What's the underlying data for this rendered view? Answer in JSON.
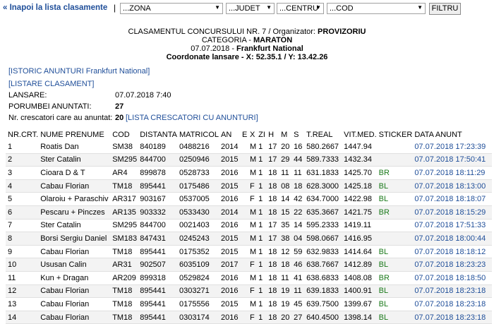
{
  "nav": {
    "back_label": "« Inapoi la lista clasamente",
    "separator": "|",
    "zona": "...ZONA",
    "judet": "...JUDET",
    "centru": "...CENTRU",
    "cod": "...COD",
    "filter_button": "FILTRU"
  },
  "header": {
    "line1_prefix": "CLASAMENTUL CONCURSULUI NR. 7 / Organizator: ",
    "line1_bold": "PROVIZORIU",
    "line2_prefix": "CATEGORIA - ",
    "line2_bold": "MARATON",
    "line3_prefix": "07.07.2018 - ",
    "line3_bold": "Frankfurt National",
    "line4": "Coordonate lansare - X: 52.35.1 / Y: 13.42.26"
  },
  "links": {
    "istoric": "[ISTORIC ANUNTURI Frankfurt National]",
    "listare": "[LISTARE CLASAMENT]",
    "lista_crescatori": "[LISTA CRESCATORI CU ANUNTURI]"
  },
  "info": {
    "lansare_label": "LANSARE:",
    "lansare_value": "07.07.2018 7:40",
    "porumbei_label": "PORUMBEI ANUNTATI:",
    "porumbei_value": "27",
    "crescatori_label": "Nr. crescatori care au anuntat:",
    "crescatori_value": "20"
  },
  "table": {
    "columns": [
      "NR.CRT.",
      "NUME PRENUME",
      "COD",
      "DISTANTA",
      "MATRICOL",
      "AN",
      "E",
      "X",
      "ZI",
      "H",
      "M",
      "S",
      "T.REAL",
      "VIT.MED.",
      "STICKER",
      "DATA ANUNT"
    ],
    "rows": [
      [
        "1",
        "Roatis Dan",
        "SM38",
        "840189",
        "0488216",
        "2014",
        "",
        "M",
        "1",
        "17",
        "20",
        "16",
        "580.2667",
        "1447.94",
        "",
        "07.07.2018 17:23:39"
      ],
      [
        "2",
        "Ster Catalin",
        "SM295",
        "844700",
        "0250946",
        "2015",
        "",
        "M",
        "1",
        "17",
        "29",
        "44",
        "589.7333",
        "1432.34",
        "",
        "07.07.2018 17:50:41"
      ],
      [
        "3",
        "Cioara D & T",
        "AR4",
        "899878",
        "0528733",
        "2016",
        "",
        "M",
        "1",
        "18",
        "11",
        "11",
        "631.1833",
        "1425.70",
        "BR",
        "07.07.2018 18:11:29"
      ],
      [
        "4",
        "Cabau Florian",
        "TM18",
        "895441",
        "0175486",
        "2015",
        "",
        "F",
        "1",
        "18",
        "08",
        "18",
        "628.3000",
        "1425.18",
        "BL",
        "07.07.2018 18:13:00"
      ],
      [
        "5",
        "Olaroiu + Paraschiv",
        "AR317",
        "903167",
        "0537005",
        "2016",
        "",
        "F",
        "1",
        "18",
        "14",
        "42",
        "634.7000",
        "1422.98",
        "BL",
        "07.07.2018 18:18:07"
      ],
      [
        "6",
        "Pescaru + Pinczes",
        "AR135",
        "903332",
        "0533430",
        "2014",
        "",
        "M",
        "1",
        "18",
        "15",
        "22",
        "635.3667",
        "1421.75",
        "BR",
        "07.07.2018 18:15:29"
      ],
      [
        "7",
        "Ster Catalin",
        "SM295",
        "844700",
        "0021403",
        "2016",
        "",
        "M",
        "1",
        "17",
        "35",
        "14",
        "595.2333",
        "1419.11",
        "",
        "07.07.2018 17:51:33"
      ],
      [
        "8",
        "Borsi Sergiu Daniel",
        "SM183",
        "847431",
        "0245243",
        "2015",
        "",
        "M",
        "1",
        "17",
        "38",
        "04",
        "598.0667",
        "1416.95",
        "",
        "07.07.2018 18:00:44"
      ],
      [
        "9",
        "Cabau Florian",
        "TM18",
        "895441",
        "0175352",
        "2015",
        "",
        "M",
        "1",
        "18",
        "12",
        "59",
        "632.9833",
        "1414.64",
        "BL",
        "07.07.2018 18:18:12"
      ],
      [
        "10",
        "Ususan Calin",
        "AR31",
        "902507",
        "6035109",
        "2017",
        "",
        "F",
        "1",
        "18",
        "18",
        "46",
        "638.7667",
        "1412.89",
        "BL",
        "07.07.2018 18:23:23"
      ],
      [
        "11",
        "Kun + Dragan",
        "AR209",
        "899318",
        "0529824",
        "2016",
        "",
        "M",
        "1",
        "18",
        "11",
        "41",
        "638.6833",
        "1408.08",
        "BR",
        "07.07.2018 18:18:50"
      ],
      [
        "12",
        "Cabau Florian",
        "TM18",
        "895441",
        "0303271",
        "2016",
        "",
        "F",
        "1",
        "18",
        "19",
        "11",
        "639.1833",
        "1400.91",
        "BL",
        "07.07.2018 18:23:18"
      ],
      [
        "13",
        "Cabau Florian",
        "TM18",
        "895441",
        "0175556",
        "2015",
        "",
        "M",
        "1",
        "18",
        "19",
        "45",
        "639.7500",
        "1399.67",
        "BL",
        "07.07.2018 18:23:18"
      ],
      [
        "14",
        "Cabau Florian",
        "TM18",
        "895441",
        "0303174",
        "2016",
        "",
        "F",
        "1",
        "18",
        "20",
        "27",
        "640.4500",
        "1398.14",
        "BL",
        "07.07.2018 18:23:18"
      ]
    ]
  }
}
